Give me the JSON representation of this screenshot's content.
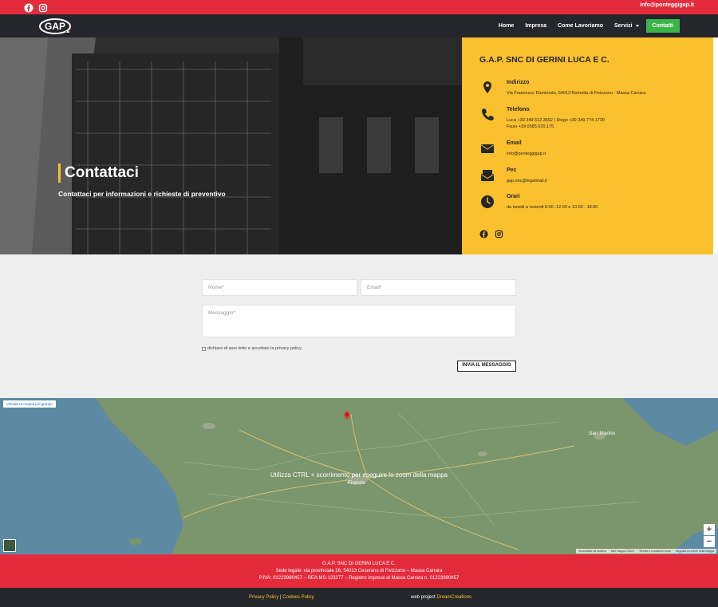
{
  "topbar": {
    "email": "info@ponteggigap.it",
    "icons": [
      "facebook-icon",
      "instagram-icon"
    ]
  },
  "nav": {
    "logo_text": "GAP",
    "items": [
      "Home",
      "Impresa",
      "Come Lavoriamo",
      "Servizi"
    ],
    "cta": "Contatti"
  },
  "hero": {
    "title": "Contattaci",
    "subtitle": "Contattaci per informazioni e richieste di preventivo"
  },
  "contact": {
    "company": "G.A.P. SNC DI GERINI LUCA E C.",
    "address_label": "Indirizzo",
    "address_value": "Via Francesco Riomondo, 54013 Rometta di Fivizzano - Massa Carrara",
    "phone_label": "Telefono",
    "phone_value_1": "Luca +39 349.512.3552 | Diego +39 349.774.1730",
    "phone_value_2": "Fisso +39 0585.020.175",
    "email_label": "Email",
    "email_value": "info@ponteggigap.it",
    "pec_label": "Pec",
    "pec_value": "gap.snc@legalmail.it",
    "hours_label": "Orari",
    "hours_value": "da lunedi a venerdi 8:00 -12:00 e 13:00 - 18:00"
  },
  "form": {
    "name_placeholder": "Nome*",
    "email_placeholder": "Email*",
    "message_placeholder": "Messaggio*",
    "privacy_text": "dichiaro di aver letto e accettato la privacy policy",
    "submit": "INVIA IL MESSAGGIO"
  },
  "map": {
    "bigger_map_link": "Visualizza mappa più grande",
    "zoom_hint": "Utilizza CTRL + scorrimento per eseguire lo zoom della mappa",
    "labels": {
      "florence": "Firenze",
      "san_marino": "San Marino"
    },
    "attribution": [
      "Scorciatoie da tastiera",
      "Dati mappa ©2022",
      "Termini e condizioni d'uso",
      "Segnala un errore nella mappa"
    ],
    "zoom_in": "+",
    "zoom_out": "−"
  },
  "footer": {
    "line1": "G.A.P. SNC DI GERINI LUCA E C.",
    "line2": "Sede legale: via provinciale 26, 54013 Ceserano di Fivizzano – Massa Carrara",
    "line3": "P.IVA: 01223980457 – REA:MS-123277 – Registro imprese di Massa Carrara n. 01223980457",
    "privacy": "Privacy Policy",
    "separator": "|",
    "cookies": "Cookies Policy",
    "web_project": "web project",
    "agency": "DreamCreations"
  }
}
